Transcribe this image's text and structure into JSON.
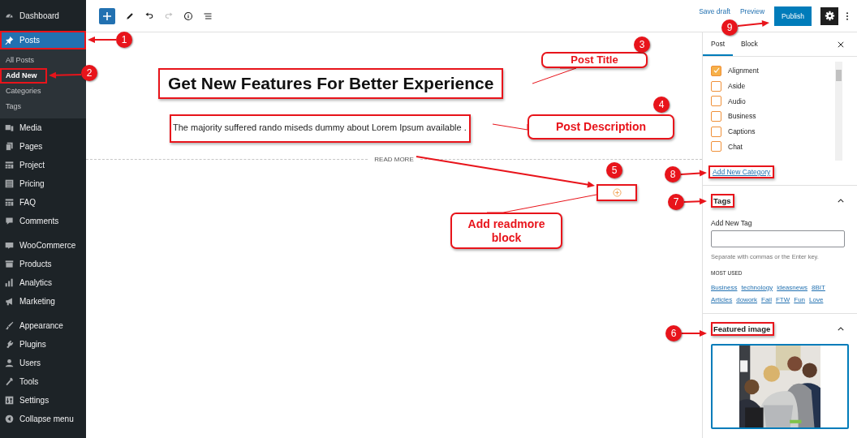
{
  "sidebar": {
    "groups": [
      [
        {
          "label": "Dashboard",
          "selected": false,
          "highlighted": false
        }
      ],
      [
        {
          "label": "Posts",
          "selected": true,
          "highlighted": true,
          "children": [
            {
              "label": "All Posts",
              "selected": false,
              "highlighted": false
            },
            {
              "label": "Add New",
              "selected": true,
              "highlighted": true
            },
            {
              "label": "Categories",
              "selected": false,
              "highlighted": false
            },
            {
              "label": "Tags",
              "selected": false,
              "highlighted": false
            }
          ]
        },
        {
          "label": "Media",
          "selected": false,
          "highlighted": false
        },
        {
          "label": "Pages",
          "selected": false,
          "highlighted": false
        },
        {
          "label": "Project",
          "selected": false,
          "highlighted": false
        },
        {
          "label": "Pricing",
          "selected": false,
          "highlighted": false
        },
        {
          "label": "FAQ",
          "selected": false,
          "highlighted": false
        },
        {
          "label": "Comments",
          "selected": false,
          "highlighted": false
        }
      ],
      [
        {
          "label": "WooCommerce",
          "selected": false,
          "highlighted": false
        },
        {
          "label": "Products",
          "selected": false,
          "highlighted": false
        },
        {
          "label": "Analytics",
          "selected": false,
          "highlighted": false
        },
        {
          "label": "Marketing",
          "selected": false,
          "highlighted": false
        }
      ],
      [
        {
          "label": "Appearance",
          "selected": false,
          "highlighted": false
        },
        {
          "label": "Plugins",
          "selected": false,
          "highlighted": false
        },
        {
          "label": "Users",
          "selected": false,
          "highlighted": false
        },
        {
          "label": "Tools",
          "selected": false,
          "highlighted": false
        },
        {
          "label": "Settings",
          "selected": false,
          "highlighted": false
        },
        {
          "label": "Collapse menu",
          "selected": false,
          "highlighted": false
        }
      ]
    ]
  },
  "toolbar": {
    "redo_disabled": true,
    "save_draft": "Save draft",
    "preview": "Preview",
    "publish": "Publish"
  },
  "editor": {
    "title": "Get New Features For Better Experience",
    "title_highlighted": true,
    "description": "The majority suffered rando miseds dummy about Lorem Ipsum available .",
    "description_highlighted": true,
    "read_more": "READ MORE",
    "add_block_highlighted": true
  },
  "panel": {
    "tabs": [
      {
        "label": "Post",
        "selected": true
      },
      {
        "label": "Block",
        "selected": false
      }
    ],
    "categories": [
      {
        "label": "Alignment",
        "checked": true
      },
      {
        "label": "Aside",
        "checked": false
      },
      {
        "label": "Audio",
        "checked": false
      },
      {
        "label": "Business",
        "checked": false
      },
      {
        "label": "Captions",
        "checked": false
      },
      {
        "label": "Chat",
        "checked": false
      }
    ],
    "add_category": "Add New Category",
    "add_category_highlighted": true,
    "tags": {
      "title": "Tags",
      "highlighted": true,
      "expanded": true,
      "field_label": "Add New Tag",
      "help": "Separate with commas or the Enter key.",
      "most_used": "MOST USED",
      "list": [
        "Business",
        "technology",
        "ideasnews",
        "8BIT",
        "Articles",
        "dowork",
        "Fail",
        "FTW",
        "Fun",
        "Love"
      ]
    },
    "featured_image": {
      "title": "Featured image",
      "highlighted": true,
      "expanded": true
    }
  },
  "annotations": {
    "markers": [
      {
        "number": "1"
      },
      {
        "number": "2"
      },
      {
        "number": "3"
      },
      {
        "number": "4"
      },
      {
        "number": "5"
      },
      {
        "number": "6"
      },
      {
        "number": "7"
      },
      {
        "number": "8"
      },
      {
        "number": "9"
      }
    ],
    "callouts": [
      "Post Title",
      "Post Description",
      "Add readmore block"
    ]
  }
}
